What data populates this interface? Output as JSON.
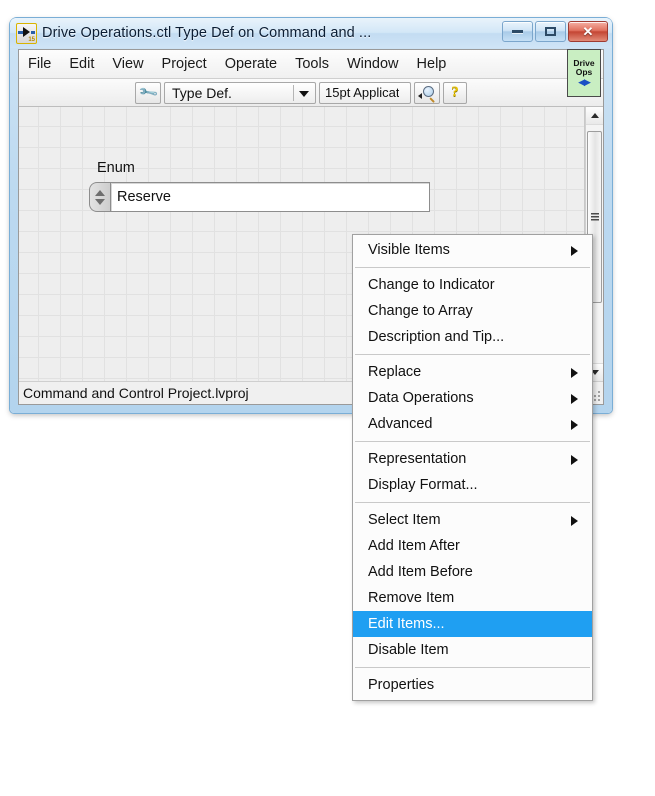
{
  "window": {
    "title": "Drive Operations.ctl Type Def on Command and ...",
    "icon": "labview-control-icon",
    "buttons": {
      "minimize": "minimize-icon",
      "maximize": "maximize-icon",
      "close": "close-icon",
      "close_glyph": "✕"
    }
  },
  "menubar": {
    "items": [
      {
        "label": "File"
      },
      {
        "label": "Edit"
      },
      {
        "label": "View"
      },
      {
        "label": "Project"
      },
      {
        "label": "Operate"
      },
      {
        "label": "Tools"
      },
      {
        "label": "Window"
      },
      {
        "label": "Help"
      }
    ],
    "connector_pane": {
      "line1": "Drive",
      "line2": "Ops",
      "arrows": "◀▶"
    }
  },
  "toolbar": {
    "wrench_icon": "wrench-icon",
    "typedef_status": "Type Def.",
    "font_value": "15pt Applicat",
    "magnifier_icon": "magnifier-icon",
    "help_icon": "help-question-icon"
  },
  "canvas": {
    "control": {
      "label": "Enum",
      "value": "Reserve",
      "spinner_up": "increment-arrow",
      "spinner_down": "decrement-arrow"
    }
  },
  "scrollbar": {
    "up_arrow": "scroll-up-arrow",
    "down_arrow": "scroll-down-arrow",
    "thumb_grip": "scroll-thumb-grip"
  },
  "statusbar": {
    "text": "Command and Control Project.lvproj",
    "resize_grip": "resize-grip-icon"
  },
  "context_menu": {
    "highlight_color": "#1f9ff2",
    "items": [
      {
        "label": "Visible Items",
        "submenu": true,
        "separator_after": true,
        "selected": false
      },
      {
        "label": "Change to Indicator",
        "submenu": false,
        "separator_after": false,
        "selected": false
      },
      {
        "label": "Change to Array",
        "submenu": false,
        "separator_after": false,
        "selected": false
      },
      {
        "label": "Description and Tip...",
        "submenu": false,
        "separator_after": true,
        "selected": false
      },
      {
        "label": "Replace",
        "submenu": true,
        "separator_after": false,
        "selected": false
      },
      {
        "label": "Data Operations",
        "submenu": true,
        "separator_after": false,
        "selected": false
      },
      {
        "label": "Advanced",
        "submenu": true,
        "separator_after": true,
        "selected": false
      },
      {
        "label": "Representation",
        "submenu": true,
        "separator_after": false,
        "selected": false
      },
      {
        "label": "Display Format...",
        "submenu": false,
        "separator_after": true,
        "selected": false
      },
      {
        "label": "Select Item",
        "submenu": true,
        "separator_after": false,
        "selected": false
      },
      {
        "label": "Add Item After",
        "submenu": false,
        "separator_after": false,
        "selected": false
      },
      {
        "label": "Add Item Before",
        "submenu": false,
        "separator_after": false,
        "selected": false
      },
      {
        "label": "Remove Item",
        "submenu": false,
        "separator_after": false,
        "selected": false
      },
      {
        "label": "Edit Items...",
        "submenu": false,
        "separator_after": false,
        "selected": true
      },
      {
        "label": "Disable Item",
        "submenu": false,
        "separator_after": true,
        "selected": false
      },
      {
        "label": "Properties",
        "submenu": false,
        "separator_after": false,
        "selected": false
      }
    ]
  }
}
